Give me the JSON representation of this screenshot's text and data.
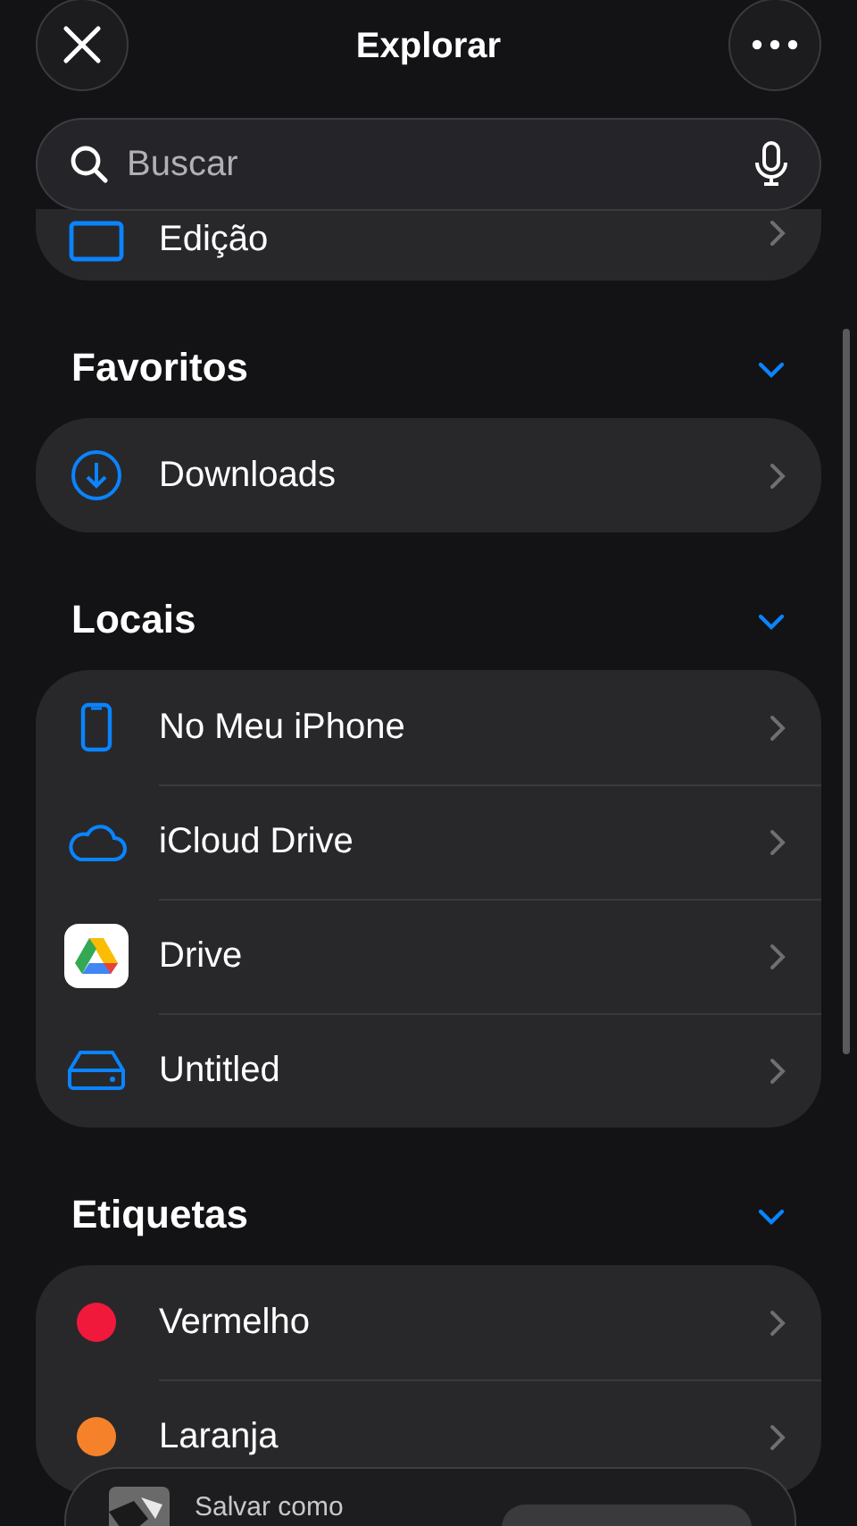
{
  "header": {
    "title": "Explorar"
  },
  "search": {
    "placeholder": "Buscar"
  },
  "sections": [
    {
      "items": [
        {
          "kind": "folder",
          "label": "Edição"
        }
      ]
    },
    {
      "title": "Favoritos",
      "expanded": true,
      "items": [
        {
          "kind": "download",
          "label": "Downloads"
        }
      ]
    },
    {
      "title": "Locais",
      "expanded": true,
      "items": [
        {
          "kind": "phone",
          "label": "No Meu iPhone"
        },
        {
          "kind": "cloud",
          "label": "iCloud Drive"
        },
        {
          "kind": "app",
          "label": "Drive"
        },
        {
          "kind": "disk",
          "label": "Untitled"
        }
      ]
    },
    {
      "title": "Etiquetas",
      "expanded": true,
      "items": [
        {
          "kind": "tag",
          "label": "Vermelho",
          "color": "#f0193c"
        },
        {
          "kind": "tag",
          "label": "Laranja",
          "color": "#f5822a"
        }
      ]
    }
  ],
  "save_sheet": {
    "title": "Salvar como"
  }
}
